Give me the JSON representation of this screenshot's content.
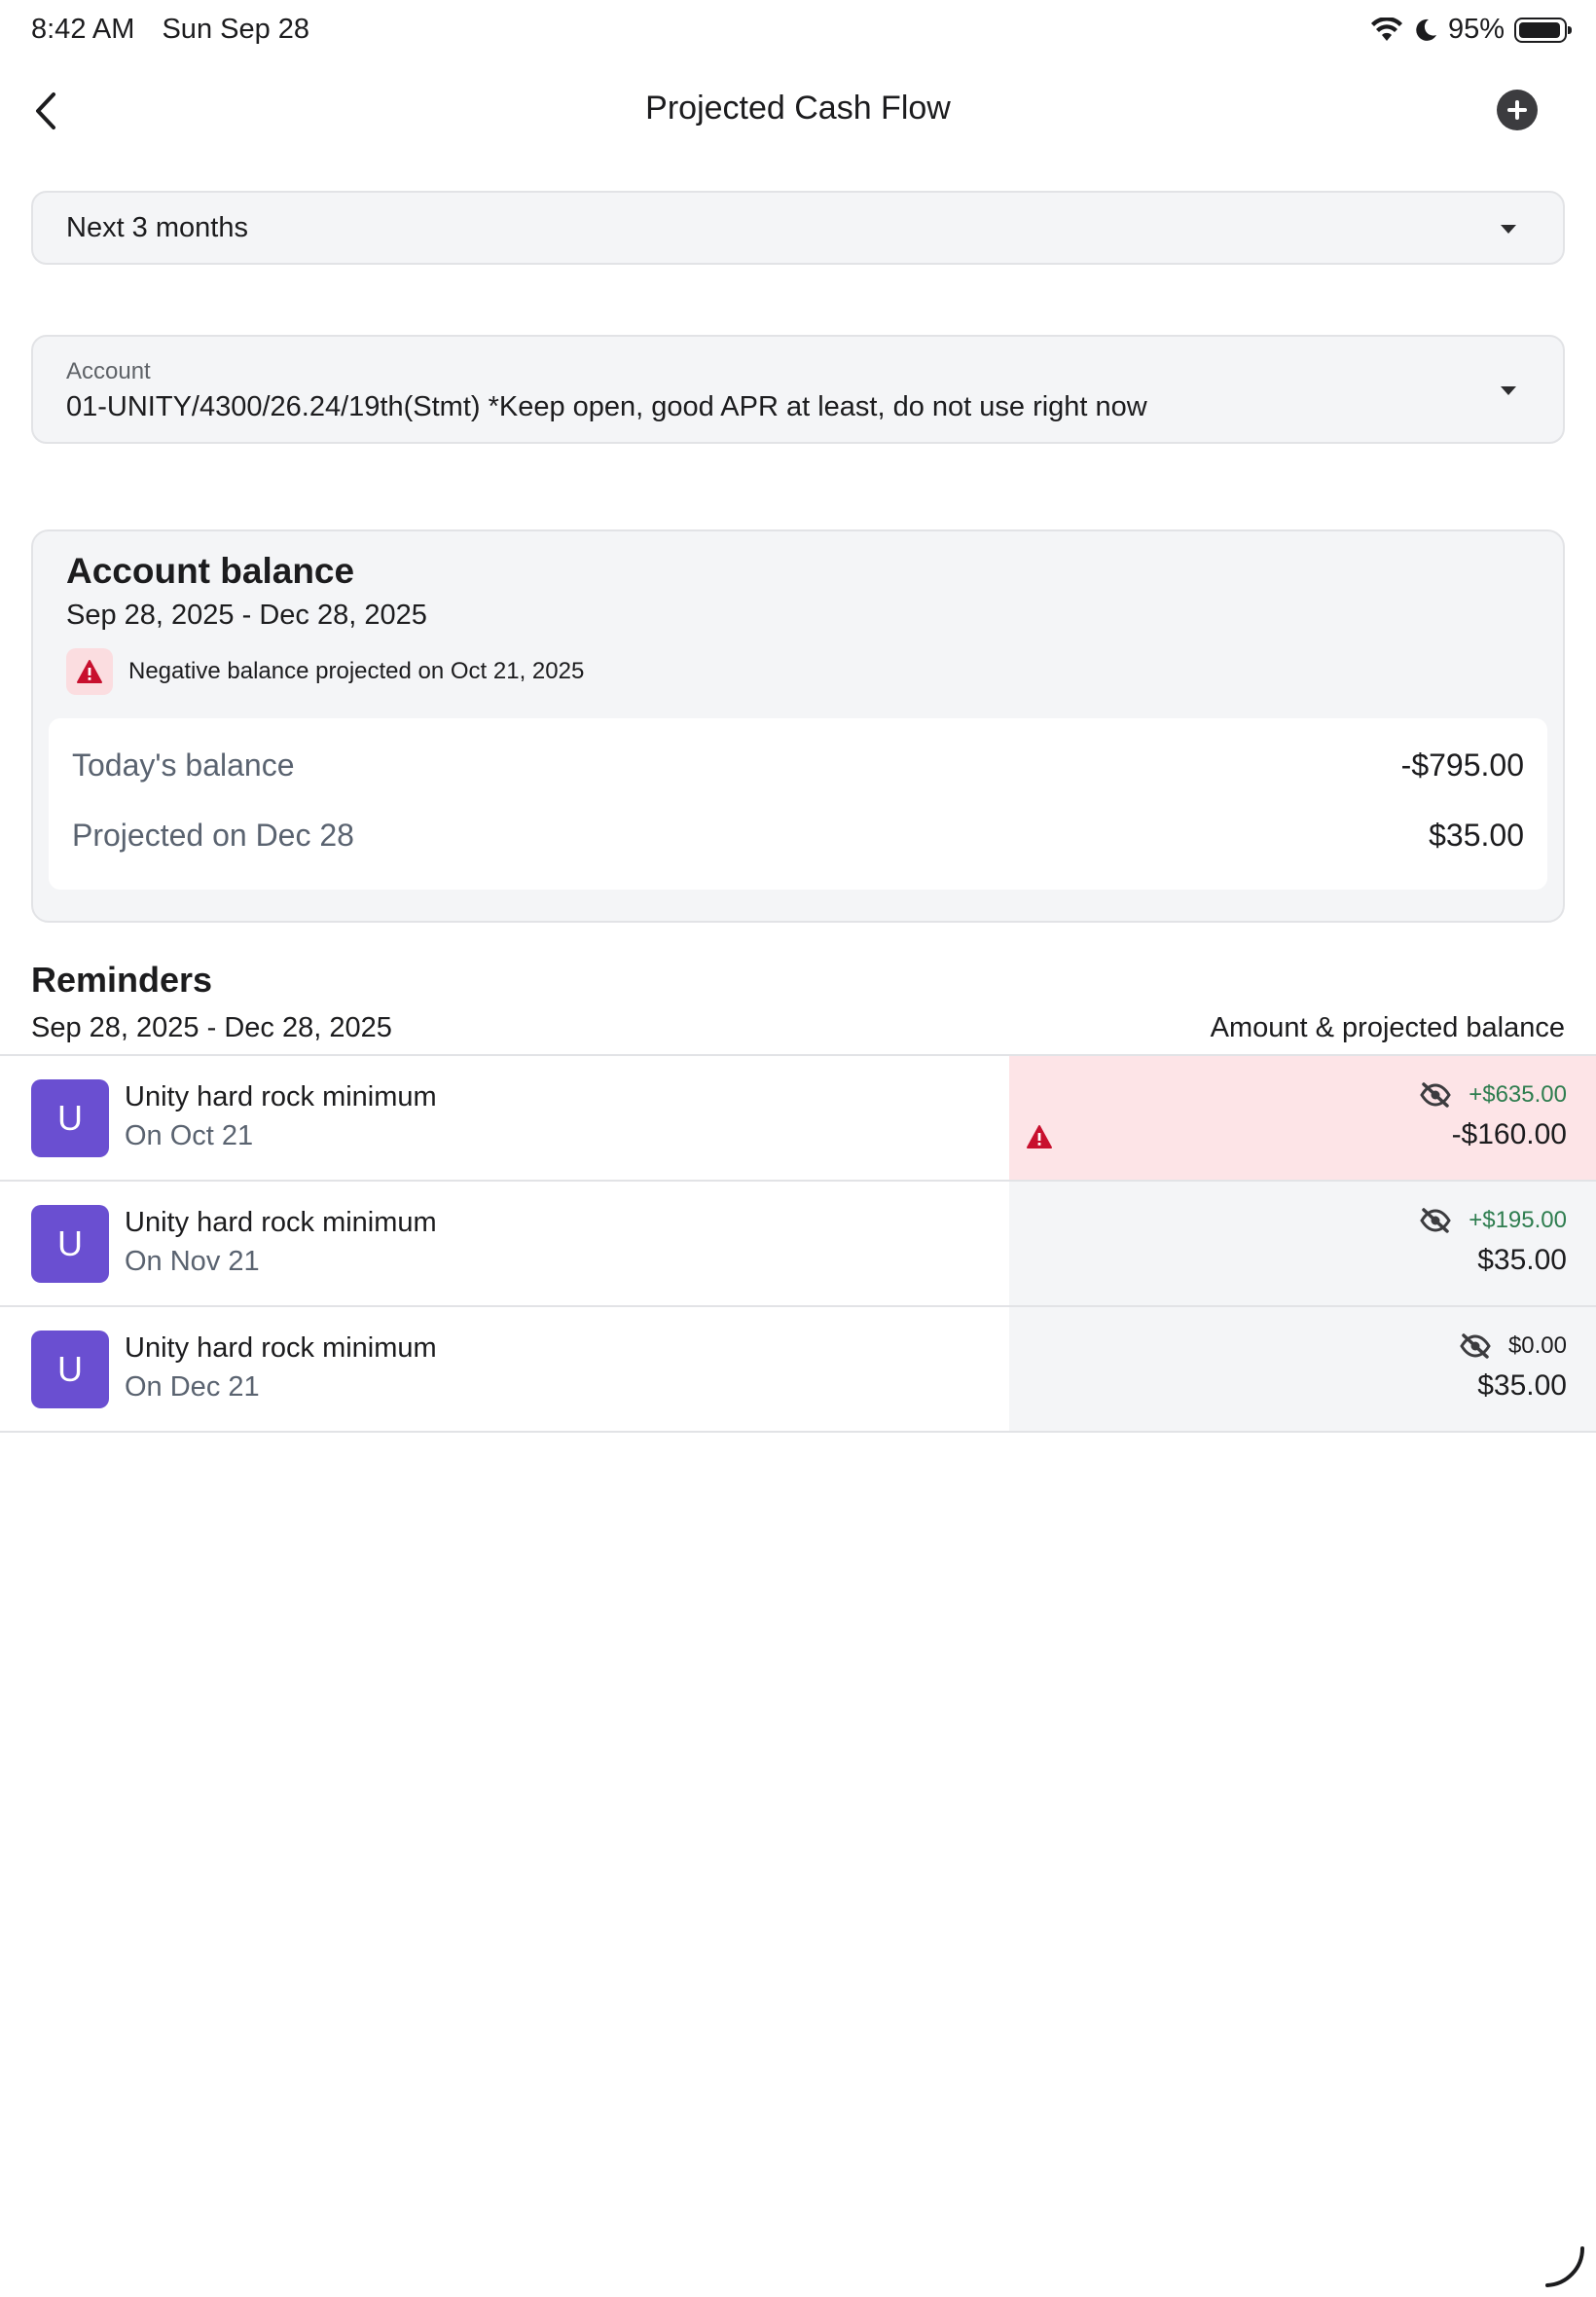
{
  "status_bar": {
    "time": "8:42 AM",
    "date": "Sun Sep 28",
    "battery": "95%",
    "battery_level": 0.95
  },
  "nav": {
    "title": "Projected Cash Flow",
    "back_icon": "chevron-left-icon",
    "add_icon": "plus-circle-icon"
  },
  "period_select": {
    "value": "Next 3 months"
  },
  "account_select": {
    "label": "Account",
    "value": "01-UNITY/4300/26.24/19th(Stmt) *Keep open, good APR at least, do not use right now"
  },
  "balance_card": {
    "title": "Account balance",
    "range": "Sep 28, 2025 - Dec 28, 2025",
    "warning": "Negative balance projected on Oct 21, 2025",
    "rows": [
      {
        "label": "Today's balance",
        "amount": "-$795.00"
      },
      {
        "label": "Projected on Dec 28",
        "amount": "$35.00"
      }
    ]
  },
  "reminders": {
    "title": "Reminders",
    "range": "Sep 28, 2025 - Dec 28, 2025",
    "column_header": "Amount & projected balance",
    "items": [
      {
        "avatar": "U",
        "name": "Unity hard rock minimum",
        "date": "On Oct 21",
        "amount": "+$635.00",
        "projected": "-$160.00",
        "negative": true
      },
      {
        "avatar": "U",
        "name": "Unity hard rock minimum",
        "date": "On Nov 21",
        "amount": "+$195.00",
        "projected": "$35.00",
        "negative": false
      },
      {
        "avatar": "U",
        "name": "Unity hard rock minimum",
        "date": "On Dec 21",
        "amount": "$0.00",
        "projected": "$35.00",
        "negative": false
      }
    ]
  },
  "colors": {
    "accent_purple": "#6a4fd1",
    "warning_red": "#c8102e",
    "positive_green": "#2e7d4f",
    "negative_row_bg": "#fde4e7"
  }
}
